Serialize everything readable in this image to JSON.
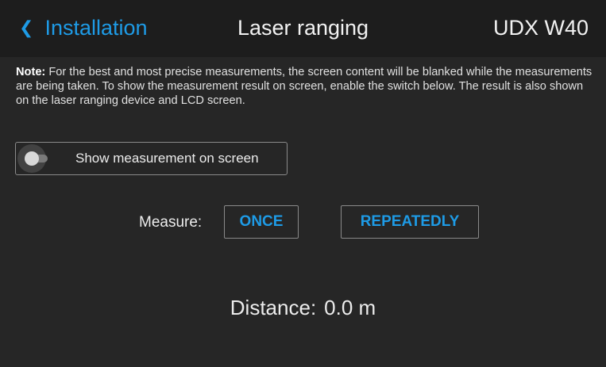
{
  "header": {
    "back_label": "Installation",
    "title": "Laser ranging",
    "model": "UDX W40"
  },
  "note": {
    "prefix": "Note:",
    "text": "For the best and most precise measurements, the screen content will be blanked while the measurements are being taken. To show the measurement result on screen, enable the switch below. The result is also shown on the laser ranging device and LCD screen."
  },
  "toggle": {
    "label": "Show measurement on screen",
    "state": "off"
  },
  "measure": {
    "label": "Measure:",
    "once_label": "ONCE",
    "repeatedly_label": "REPEATEDLY"
  },
  "distance": {
    "label": "Distance:",
    "value": "0.0 m"
  },
  "colors": {
    "accent": "#1e9be6",
    "background": "#262626",
    "header_background": "#1d1d1d"
  }
}
